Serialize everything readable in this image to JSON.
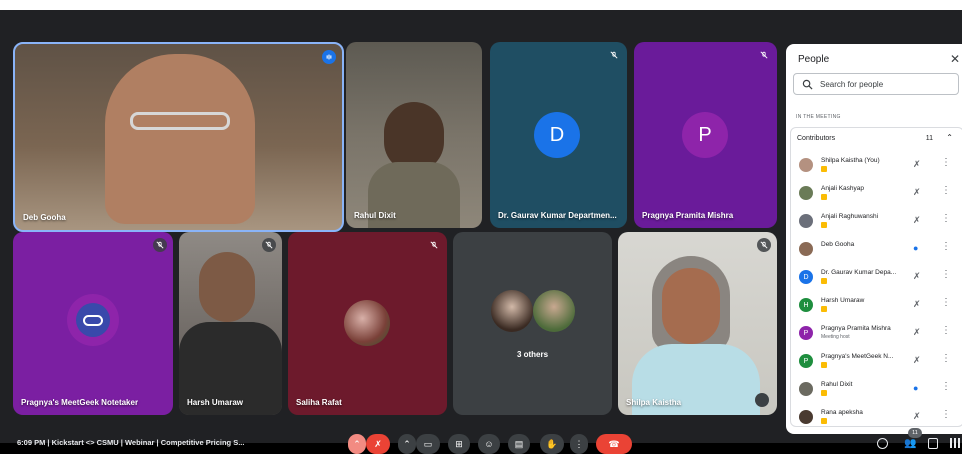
{
  "colors": {
    "accent": "#1a73e8",
    "danger": "#ea4335",
    "pin": "#fbbc04"
  },
  "tiles": {
    "deb": {
      "name": "Deb Gooha"
    },
    "rahul": {
      "name": "Rahul Dixit"
    },
    "gaurav": {
      "name": "Dr. Gaurav Kumar Departmen...",
      "initial": "D"
    },
    "pragnya": {
      "name": "Pragnya Pramita Mishra",
      "initial": "P"
    },
    "notetaker": {
      "name": "Pragnya's MeetGeek Notetaker"
    },
    "harsh": {
      "name": "Harsh Umaraw"
    },
    "saliha": {
      "name": "Saliha Rafat"
    },
    "others": {
      "label": "3 others"
    },
    "shilpa": {
      "name": "Shilpa Kaistha"
    }
  },
  "people_panel": {
    "title": "People",
    "search_placeholder": "Search for people",
    "section_label": "IN THE MEETING",
    "group_label": "Contributors",
    "group_count": "11",
    "people": [
      {
        "name": "Shilpa Kaistha (You)",
        "sub": ""
      },
      {
        "name": "Anjali Kashyap",
        "sub": ""
      },
      {
        "name": "Anjali Raghuwanshi",
        "sub": ""
      },
      {
        "name": "Deb Gooha",
        "sub": ""
      },
      {
        "name": "Dr. Gaurav Kumar Depa...",
        "sub": "",
        "initial": "D"
      },
      {
        "name": "Harsh Umaraw",
        "sub": "",
        "initial": "H"
      },
      {
        "name": "Pragnya Pramita Mishra",
        "sub": "Meeting host",
        "initial": "P"
      },
      {
        "name": "Pragnya's MeetGeek N...",
        "sub": "",
        "initial": "P"
      },
      {
        "name": "Rahul Dixit",
        "sub": ""
      },
      {
        "name": "Rana apeksha",
        "sub": ""
      }
    ]
  },
  "bottom_bar": {
    "meeting_info": "6:09 PM  |  Kickstart <> CSMU | Webinar | Competitive Pricing S...",
    "participants_count": "11"
  }
}
